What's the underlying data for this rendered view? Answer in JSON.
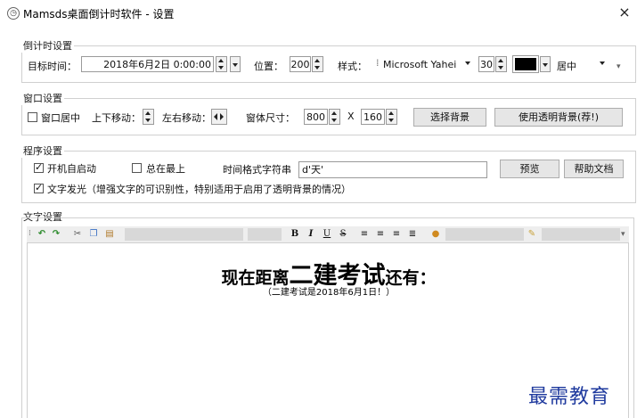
{
  "window": {
    "title": "Mamsds桌面倒计时软件 - 设置",
    "close_label": "×"
  },
  "countdown": {
    "group_label": "倒计时设置",
    "target_label": "目标时间：",
    "target_value": "2018年6月2日 0:00:00",
    "position_label": "位置：",
    "position_value": "200",
    "style_label": "样式：",
    "font_value": "Microsoft Yahei",
    "size_value": "30",
    "align_value": "居中",
    "color_value": "#000000"
  },
  "window_settings": {
    "group_label": "窗口设置",
    "center_label": "窗口居中",
    "center_checked": false,
    "vmove_label": "上下移动：",
    "hmove_label": "左右移动：",
    "size_label": "窗体尺寸：",
    "width_value": "800",
    "x_label": "X",
    "height_value": "160",
    "choose_bg_label": "选择背景",
    "transparent_bg_label": "使用透明背景(荐!)"
  },
  "program": {
    "group_label": "程序设置",
    "autostart_label": "开机自启动",
    "autostart_checked": true,
    "topmost_label": "总在最上",
    "topmost_checked": false,
    "timefmt_label": "时间格式字符串",
    "timefmt_value": "d'天'",
    "preview_label": "预览",
    "help_label": "帮助文档",
    "glow_label": "文字发光（增强文字的可识别性，特别适用于启用了透明背景的情况）",
    "glow_checked": true
  },
  "text_settings": {
    "group_label": "文字设置",
    "toolbar": {
      "bold": "B",
      "italic": "I",
      "underline": "U",
      "strike": "S"
    },
    "content": {
      "part1": "现在距离",
      "part2": "二建考试",
      "part3": "还有：",
      "subline": "（二建考试是2018年6月1日！）"
    }
  },
  "watermark": "最需教育"
}
